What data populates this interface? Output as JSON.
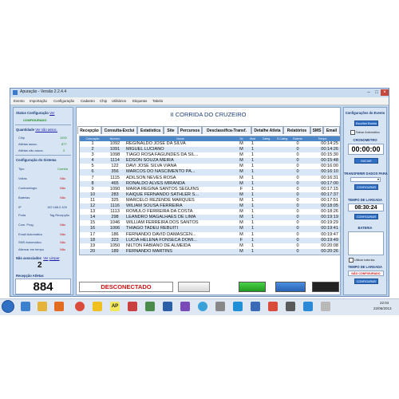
{
  "window": {
    "title": "Apuração - Versão 2.2.4.4"
  },
  "menu": [
    "Evento",
    "Importação",
    "Configuração",
    "Cadastro",
    "Chip",
    "Utilitários",
    "Etiquetas",
    "Tabela"
  ],
  "left": {
    "status_title": "Status Configuração",
    "status_link": "Ver",
    "status_value": "CONFIGURADO",
    "quantity_label": "Quantidade",
    "quantity_link": "Ver não assoc.",
    "chip_label": "Chip",
    "chip_value": "1200",
    "linked_label": "Atletas assoc.",
    "linked_value": "877",
    "unlinked_label": "Atletas não assoc.",
    "unlinked_value": "0",
    "system_title": "Configuração do Sistema",
    "rows": [
      {
        "label": "Tipo",
        "value": "Corrida"
      },
      {
        "label": "Voltas",
        "value": "Não"
      },
      {
        "label": "Contrarelogio",
        "value": "Não"
      },
      {
        "label": "Baterias",
        "value": "Não"
      },
      {
        "label": "IP",
        "value": "192.168.0.100"
      },
      {
        "label": "Porta",
        "value": "Tag Recepção"
      },
      {
        "label": "Com. Prog.",
        "value": "Não"
      },
      {
        "label": "Email Automático",
        "value": "Não"
      },
      {
        "label": "SMS Automático",
        "value": "Não"
      },
      {
        "label": "Alternar em tempo",
        "value": "Não"
      }
    ],
    "unassoc_label": "Não associados",
    "unassoc_link": "Ver",
    "unassoc_link2": "Limpar",
    "unassoc_count": "2",
    "reception_label": "Recepção Atletas",
    "reception_count": "884"
  },
  "main": {
    "race_title": "II CORRIDA DO CRUZEIRO",
    "tabs": [
      "Recepção",
      "Consulta-Exclui",
      "Estatística",
      "Site",
      "Percursos",
      "Desclassifica-Transf.",
      "Detalhe Atleta",
      "Relatórios",
      "SMS",
      "Email"
    ],
    "columns": [
      "Colocação",
      "Número",
      "Nome",
      "Sx",
      "Mod",
      "Categ.",
      "S.Categ.",
      "Bateria",
      "Tempo"
    ],
    "rows": [
      {
        "pos": "1",
        "num": "1092",
        "name": "REGINALDO JOSE DA SILVA",
        "sx": "M",
        "mod": "1",
        "bat": "0",
        "time": "00:14:25"
      },
      {
        "pos": "2",
        "num": "1091",
        "name": "MIGUEL LUCIANO",
        "sx": "M",
        "mod": "1",
        "bat": "0",
        "time": "00:14:26"
      },
      {
        "pos": "3",
        "num": "1098",
        "name": "TIAGO ROSA FAGUNDES DA SIL...",
        "sx": "M",
        "mod": "1",
        "bat": "0",
        "time": "00:15:30"
      },
      {
        "pos": "4",
        "num": "1114",
        "name": "EDSON SOUZA MEIRA",
        "sx": "M",
        "mod": "1",
        "bat": "0",
        "time": "00:15:48"
      },
      {
        "pos": "5",
        "num": "122",
        "name": "DAVI JOSE SILVA VIANA",
        "sx": "M",
        "mod": "1",
        "bat": "0",
        "time": "00:16:00"
      },
      {
        "pos": "6",
        "num": "356",
        "name": "MARCOS DO NASCIMENTO PA...",
        "sx": "M",
        "mod": "1",
        "bat": "0",
        "time": "00:16:10"
      },
      {
        "pos": "7",
        "num": "1115",
        "name": "ADILSON NEVES ROSA",
        "sx": "M",
        "mod": "1",
        "bat": "0",
        "time": "00:16:31"
      },
      {
        "pos": "8",
        "num": "465",
        "name": "RONALDO ALVES MIRANDA",
        "sx": "M",
        "mod": "1",
        "bat": "0",
        "time": "00:17:00"
      },
      {
        "pos": "9",
        "num": "1090",
        "name": "MARIA REGINA SANTOS SEGUINS",
        "sx": "F",
        "mod": "1",
        "bat": "0",
        "time": "00:17:15"
      },
      {
        "pos": "10",
        "num": "283",
        "name": "KAIQUE  FERNANDO SATHLER S...",
        "sx": "M",
        "mod": "1",
        "bat": "0",
        "time": "00:17:37"
      },
      {
        "pos": "11",
        "num": "325",
        "name": "MARCELO REZENDE MARQUES",
        "sx": "M",
        "mod": "1",
        "bat": "0",
        "time": "00:17:51"
      },
      {
        "pos": "12",
        "num": "1116",
        "name": "WILIAM SOUSA FERREIRA",
        "sx": "M",
        "mod": "1",
        "bat": "0",
        "time": "00:18:05"
      },
      {
        "pos": "13",
        "num": "1113",
        "name": "ROMULO FERREIRA DA COSTA",
        "sx": "M",
        "mod": "1",
        "bat": "0",
        "time": "00:18:26"
      },
      {
        "pos": "14",
        "num": "298",
        "name": "LEANDRO MAGALHAES DE LIMA",
        "sx": "M",
        "mod": "1",
        "bat": "0",
        "time": "00:19:19"
      },
      {
        "pos": "15",
        "num": "1046",
        "name": "WILLIAM FERREIRA DOS SANTOS",
        "sx": "M",
        "mod": "1",
        "bat": "0",
        "time": "00:19:29"
      },
      {
        "pos": "16",
        "num": "1006",
        "name": "THIAGO TADEU REBUITI",
        "sx": "M",
        "mod": "1",
        "bat": "0",
        "time": "00:19:41"
      },
      {
        "pos": "17",
        "num": "186",
        "name": "FERNANDO  DAVID DAMASCEN...",
        "sx": "M",
        "mod": "1",
        "bat": "0",
        "time": "00:19:47"
      },
      {
        "pos": "18",
        "num": "323",
        "name": "LUCIA HELENA FONSECA DOMI...",
        "sx": "F",
        "mod": "1",
        "bat": "0",
        "time": "00:19:49"
      },
      {
        "pos": "19",
        "num": "1050",
        "name": "NILTON FABIANO DE ALMEIDA",
        "sx": "M",
        "mod": "1",
        "bat": "0",
        "time": "00:20:08"
      },
      {
        "pos": "20",
        "num": "189",
        "name": "FERNANDO MARTINS",
        "sx": "M",
        "mod": "1",
        "bat": "0",
        "time": "00:20:26"
      }
    ],
    "status": "DESCONECTADO"
  },
  "right": {
    "event_title": "Configurações do Evento",
    "event_button": "Escolher Evento",
    "auto_label": "Salvar Automático",
    "stopwatch_title": "CRONOMETRO",
    "stopwatch": "00:00:00",
    "start_button": "INICIAR",
    "transfer_title": "TRANSFERIR DADOS PARA",
    "config_button": "CONFIGURAR",
    "time_title": "TEMPO DE LARGADA",
    "time_value": "08:30:24",
    "time_button": "CONFIGURAR",
    "battery_title": "BATERIA",
    "battery_check_label": "Utilizar baterias",
    "start_time_title": "TEMPO DE LARGADA",
    "not_configured": "NÃO CONFIGURADO",
    "last_button": "CONFIGURAR"
  },
  "taskbar": {
    "time": "22:04",
    "date": "22/06/2013",
    "app_label": "AP"
  },
  "colors": {
    "accent": "#2f6fc4",
    "header": "#4a86c8",
    "panel": "#d7e4f4"
  }
}
